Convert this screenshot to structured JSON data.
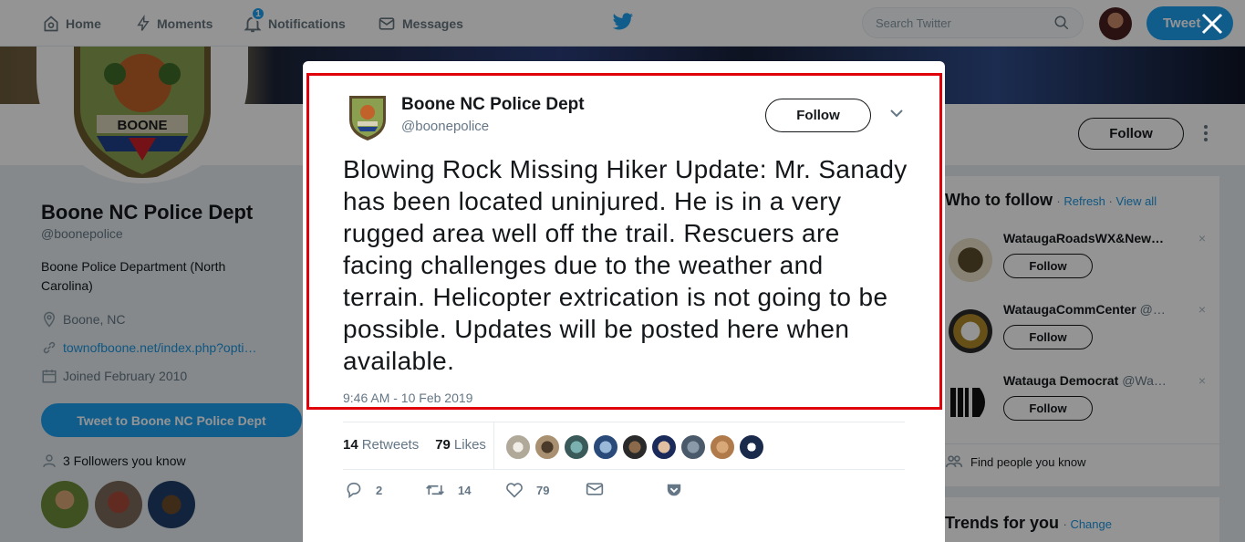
{
  "nav": {
    "home": "Home",
    "moments": "Moments",
    "notifications": "Notifications",
    "notif_count": "1",
    "messages": "Messages",
    "search_placeholder": "Search Twitter",
    "tweet_button": "Tweet"
  },
  "profile": {
    "badge_text": "BOONE",
    "name": "Boone NC Police Dept",
    "handle": "@boonepolice",
    "bio": "Boone Police Department (North Carolina)",
    "location": "Boone, NC",
    "url": "townofboone.net/index.php?opti…",
    "joined": "Joined February 2010",
    "tweet_to": "Tweet to Boone NC Police Dept",
    "followers_known": "3 Followers you know",
    "follow_label": "Follow"
  },
  "who_to_follow": {
    "title": "Who to follow",
    "refresh": "Refresh",
    "view_all": "View all",
    "separator": "·",
    "items": [
      {
        "name": "WataugaRoadsWX&New…",
        "handle": "",
        "follow": "Follow",
        "dismiss": "×"
      },
      {
        "name": "WataugaCommCenter",
        "handle": "@…",
        "follow": "Follow",
        "dismiss": "×"
      },
      {
        "name": "Watauga Democrat",
        "handle": "@Wa…",
        "follow": "Follow",
        "dismiss": "×"
      }
    ],
    "find_people": "Find people you know"
  },
  "trends": {
    "title": "Trends for you",
    "change": "Change"
  },
  "tweet": {
    "author_name": "Boone NC Police Dept",
    "author_handle": "@boonepolice",
    "follow_label": "Follow",
    "text": "Blowing Rock Missing Hiker Update: Mr. Sanady has been located uninjured. He is in a very rugged area well off the trail. Rescuers are facing challenges due to the weather and terrain. Helicopter extrication is not going to be possible. Updates will be posted here when available.",
    "timestamp": "9:46 AM - 10 Feb 2019",
    "retweets_count": "14",
    "retweets_label": "Retweets",
    "likes_count": "79",
    "likes_label": "Likes",
    "reply_count": "2",
    "retweet_count_action": "14",
    "like_count_action": "79"
  },
  "colors": {
    "twitter_blue": "#1da1f2",
    "highlight_red": "#e0000a"
  }
}
